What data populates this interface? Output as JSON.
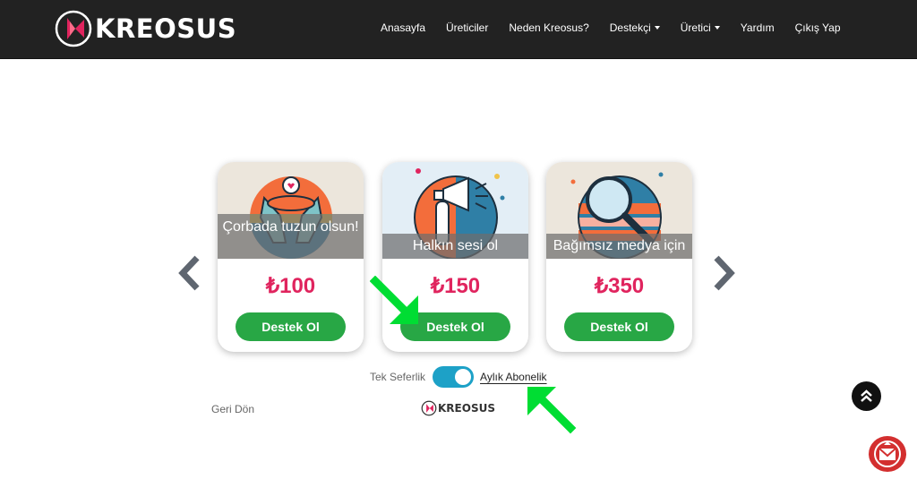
{
  "header": {
    "brand": "KREOSUS",
    "nav": [
      {
        "label": "Anasayfa",
        "dropdown": false
      },
      {
        "label": "Üreticiler",
        "dropdown": false
      },
      {
        "label": "Neden Kreosus?",
        "dropdown": false
      },
      {
        "label": "Destekçi",
        "dropdown": true
      },
      {
        "label": "Üretici",
        "dropdown": true
      },
      {
        "label": "Yardım",
        "dropdown": false
      },
      {
        "label": "Çıkış Yap",
        "dropdown": false
      }
    ]
  },
  "carousel": {
    "prev_icon": "chevron-left-icon",
    "next_icon": "chevron-right-icon",
    "cards": [
      {
        "caption": "Çorbada tuzun olsun!",
        "price": "₺100",
        "button": "Destek Ol",
        "image": "hands-heart-illustration"
      },
      {
        "caption": "Halkın sesi ol",
        "price": "₺150",
        "button": "Destek Ol",
        "image": "megaphone-illustration"
      },
      {
        "caption": "Bağımsız medya için",
        "price": "₺350",
        "button": "Destek Ol",
        "image": "magnifier-illustration"
      }
    ]
  },
  "toggle": {
    "left_label": "Tek Seferlik",
    "right_label": "Aylık Abonelik",
    "state": "on"
  },
  "footer": {
    "back_label": "Geri Dön",
    "brand": "KREOSUS"
  },
  "floating": {
    "to_top_icon": "double-chevron-up-icon",
    "help_icon": "envelope-icon"
  },
  "colors": {
    "header_bg": "#222222",
    "price": "#e0245e",
    "button": "#28a745",
    "toggle": "#1da1c7",
    "annotation": "#00dd33",
    "help_fab": "#d32f2f"
  }
}
